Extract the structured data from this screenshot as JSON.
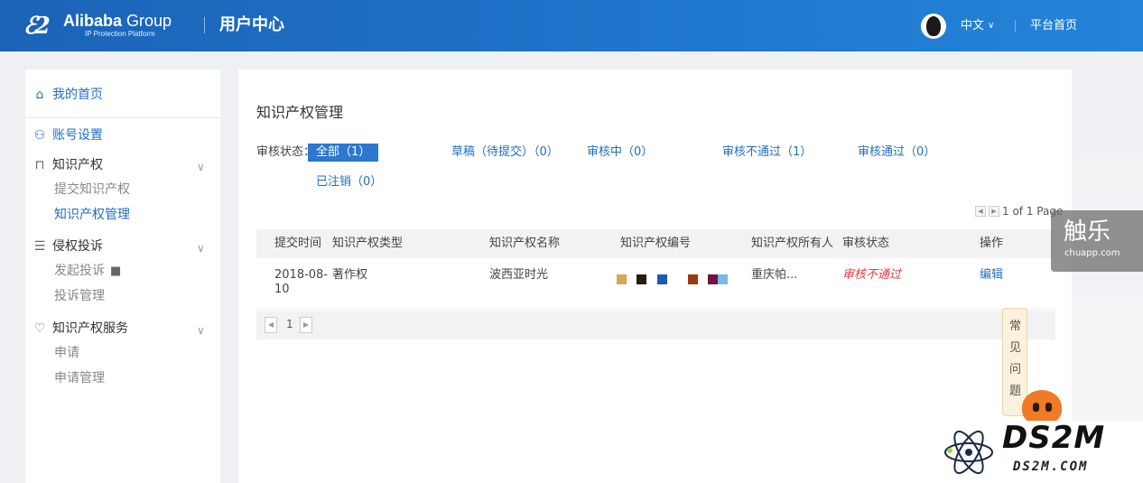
{
  "header": {
    "logo_mark": "ℰ2",
    "logo_name_bold": "Alibaba",
    "logo_name": " Group",
    "logo_sub": "IP Protection Platform",
    "title": "用户中心",
    "language": "中文",
    "platform_home": "平台首页"
  },
  "sidebar": {
    "home": "我的首页",
    "account": "账号设置",
    "ip_group": "知识产权",
    "ip_items": [
      "提交知识产权",
      "知识产权管理"
    ],
    "complaint_group": "侵权投诉",
    "complaint_items": [
      "发起投诉",
      "投诉管理"
    ],
    "service_group": "知识产权服务",
    "service_items": [
      "申请",
      "申请管理"
    ]
  },
  "main": {
    "title": "知识产权管理",
    "status_label": "审核状态：",
    "filters": [
      "全部（1）",
      "草稿（待提交）（0）",
      "审核中（0）",
      "审核不通过（1）",
      "审核通过（0）",
      "已注销（0）"
    ],
    "active_filter": 0,
    "pager_summary": "1 of 1 Page",
    "columns": [
      "提交时间",
      "知识产权类型",
      "知识产权名称",
      "知识产权编号",
      "知识产权所有人",
      "审核状态",
      "操作"
    ],
    "rows": [
      {
        "date_line1": "2018-08-",
        "date_line2": "10",
        "type": "著作权",
        "name": "波西亚时光",
        "number_redaction_colors": [
          "#d9a550",
          "#2a1a14",
          "#1d5bb0",
          "#9c3a14",
          "#6e1443",
          "#7ab8e6"
        ],
        "owner": "重庆帕...",
        "status": "审核不通过",
        "action": "编辑"
      }
    ],
    "page_number": "1"
  },
  "faq": {
    "chars": [
      "常",
      "见",
      "问",
      "题"
    ]
  },
  "watermarks": {
    "chuapp_cn": "触乐",
    "chuapp_url": "chuapp.com",
    "ds2m": "DS2M",
    "ds2m_url": "DS2M.COM"
  },
  "colors": {
    "header_blue": "#1f6fc5",
    "link_blue": "#1f6fc5",
    "reject_red": "#e03c3c",
    "active_filter_bg": "#2d78cf"
  }
}
